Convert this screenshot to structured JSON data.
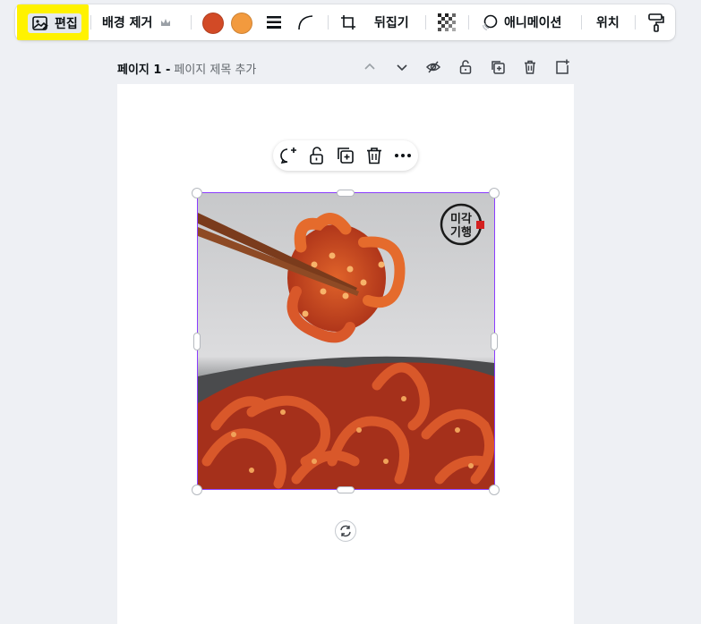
{
  "toolbar": {
    "edit_label": "편집",
    "remove_bg_label": "배경 제거",
    "flip_label": "뒤집기",
    "animate_label": "애니메이션",
    "position_label": "위치",
    "colors": [
      "#d24a26",
      "#f29a3e"
    ]
  },
  "page": {
    "number_label": "페이지 1 -",
    "title_placeholder": "페이지 제목 추가"
  },
  "image": {
    "logo_text": [
      "미각",
      "기행"
    ]
  },
  "icons": {
    "edit": "image-edit-icon",
    "premium": "crown-icon",
    "border_style": "border-lines-icon",
    "corner": "corner-rounding-icon",
    "crop": "crop-icon",
    "transparency": "transparency-icon",
    "animate": "animate-icon",
    "paint": "paint-roller-icon",
    "comment": "add-comment-icon",
    "lock": "unlock-icon",
    "duplicate": "duplicate-icon",
    "delete": "trash-icon",
    "more": "more-icon",
    "rotate": "rotate-icon"
  }
}
